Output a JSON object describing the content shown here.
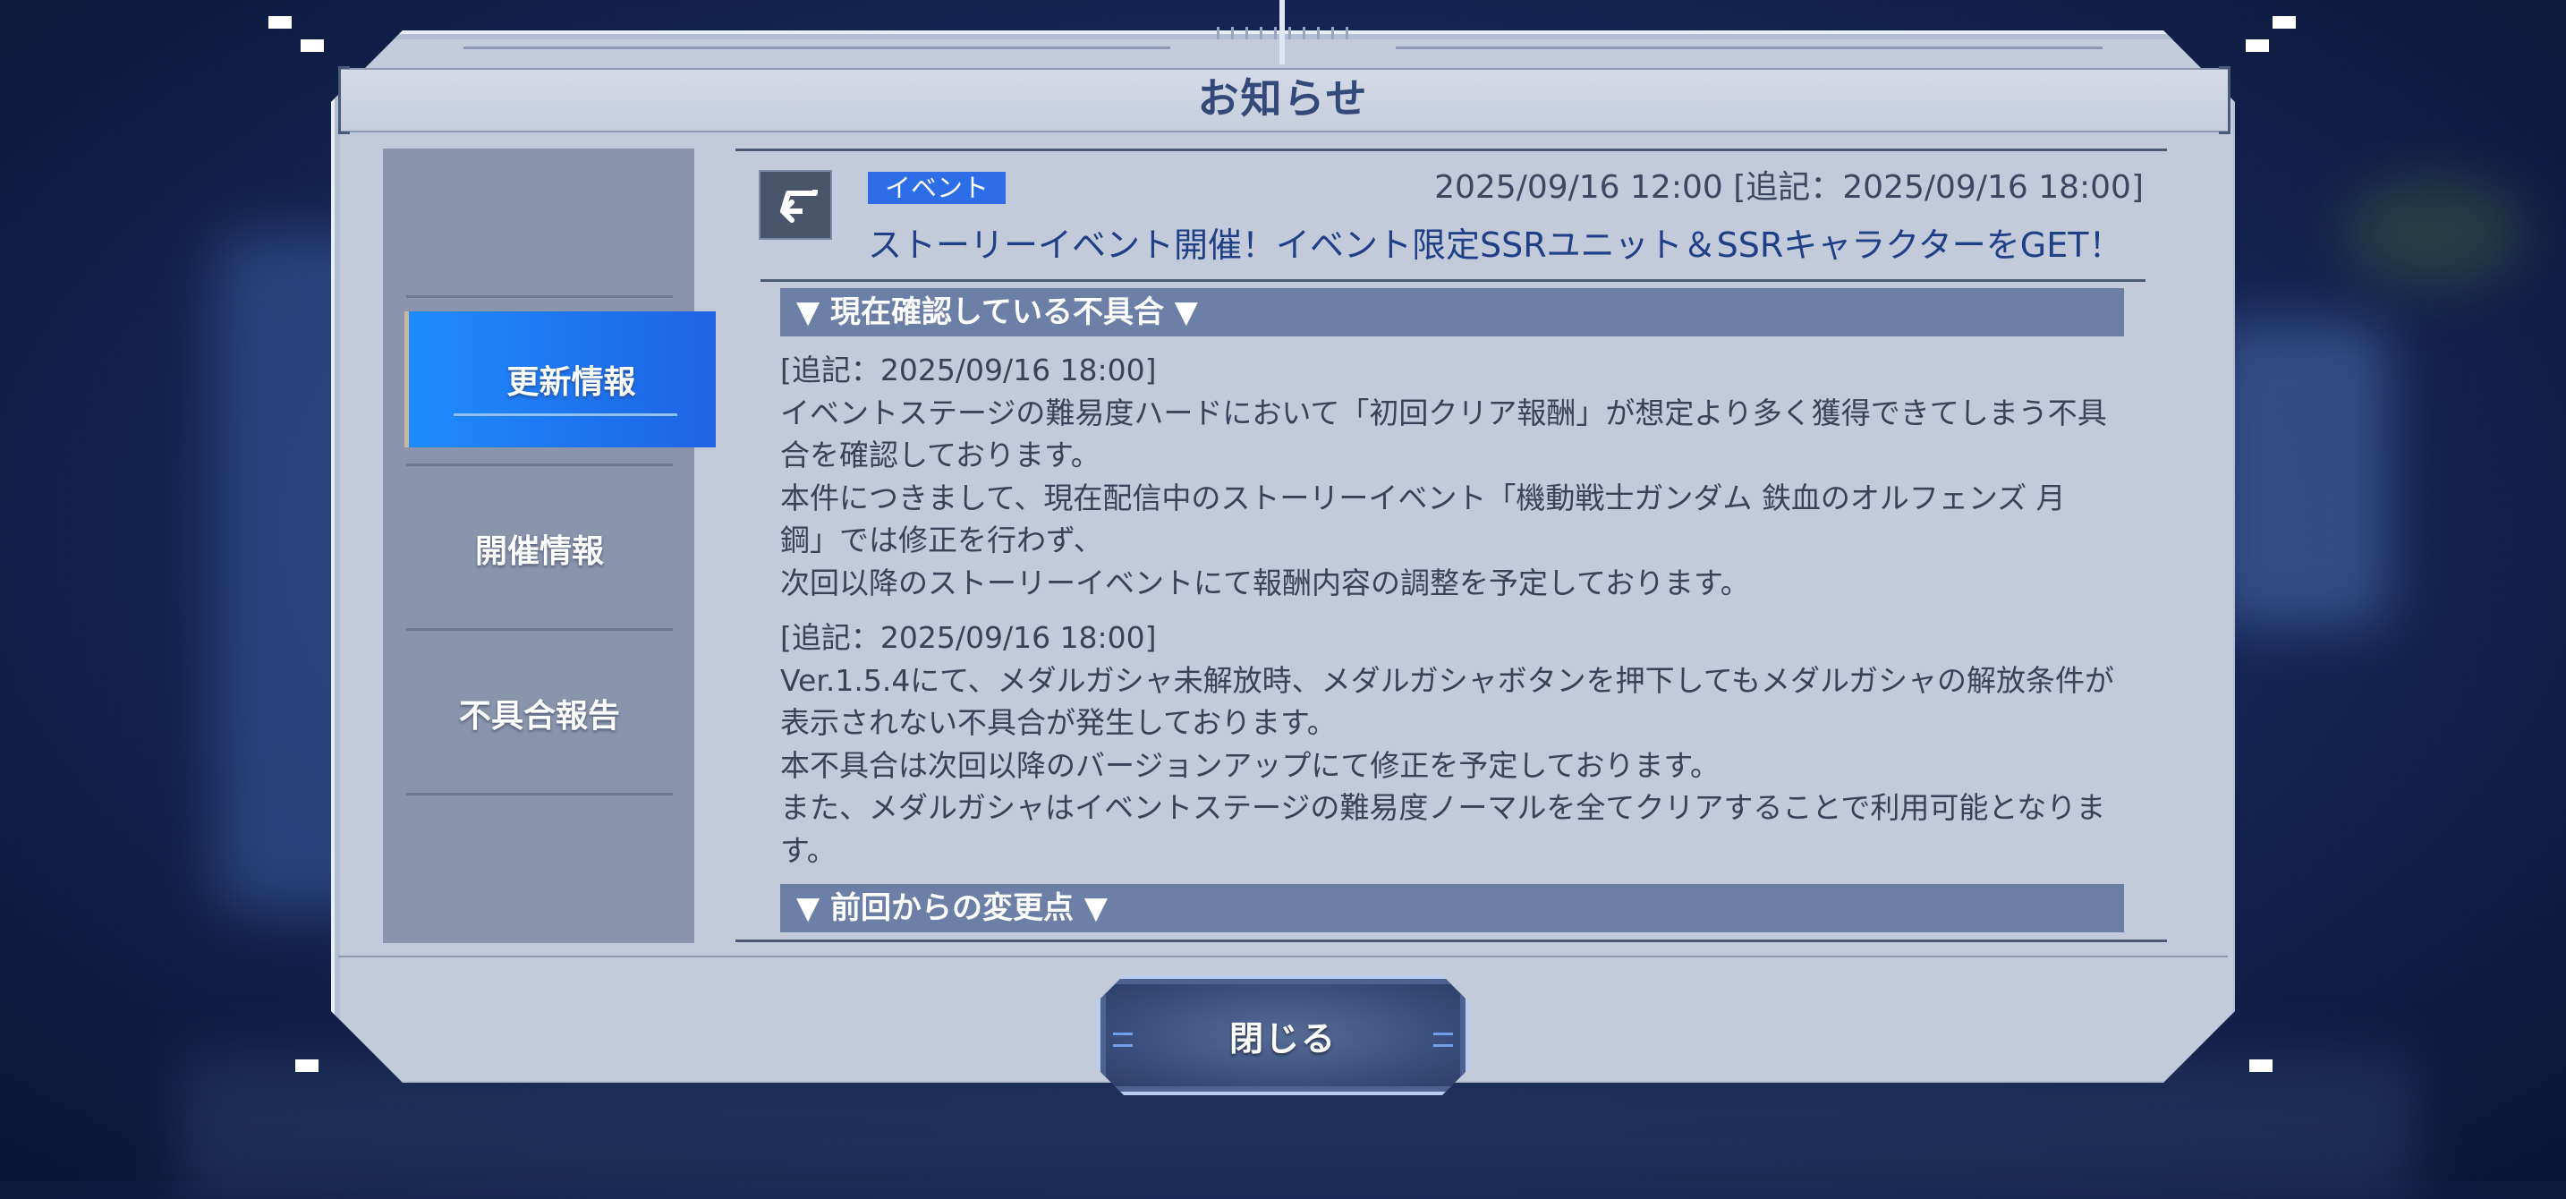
{
  "dialog": {
    "title": "お知らせ",
    "close_label": "閉じる"
  },
  "sidebar": {
    "items": [
      {
        "label": "更新情報",
        "active": true
      },
      {
        "label": "開催情報",
        "active": false
      },
      {
        "label": "不具合報告",
        "active": false
      }
    ]
  },
  "article": {
    "tag": "イベント",
    "date": "2025/09/16 12:00 [追記：2025/09/16 18:00]",
    "title": "ストーリーイベント開催！イベント限定SSRユニット＆SSRキャラクターをGET！",
    "section1": "▼ 現在確認している不具合 ▼",
    "p1": [
      "[追記：2025/09/16 18:00]",
      "イベントステージの難易度ハードにおいて「初回クリア報酬」が想定より多く獲得できてしまう不具",
      "合を確認しております。",
      "本件につきまして、現在配信中のストーリーイベント「機動戦士ガンダム 鉄血のオルフェンズ 月",
      "鋼」では修正を行わず、",
      "次回以降のストーリーイベントにて報酬内容の調整を予定しております。"
    ],
    "p2": [
      "[追記：2025/09/16 18:00]",
      "Ver.1.5.4にて、メダルガシャ未解放時、メダルガシャボタンを押下してもメダルガシャの解放条件が",
      "表示されない不具合が発生しております。",
      "本不具合は次回以降のバージョンアップにて修正を予定しております。",
      "また、メダルガシャはイベントステージの難易度ノーマルを全てクリアすることで利用可能となりま",
      "す。"
    ],
    "section2": "▼ 前回からの変更点 ▼"
  },
  "colors": {
    "panel": "#c3cada",
    "sidebar": "#8a95ad",
    "active_tab": "#1e74f2",
    "tag": "#2d6ee8",
    "section_bar": "#6c7fa7",
    "title_text": "#1f3f86"
  },
  "icons": {
    "back": "return-arrow-icon"
  }
}
